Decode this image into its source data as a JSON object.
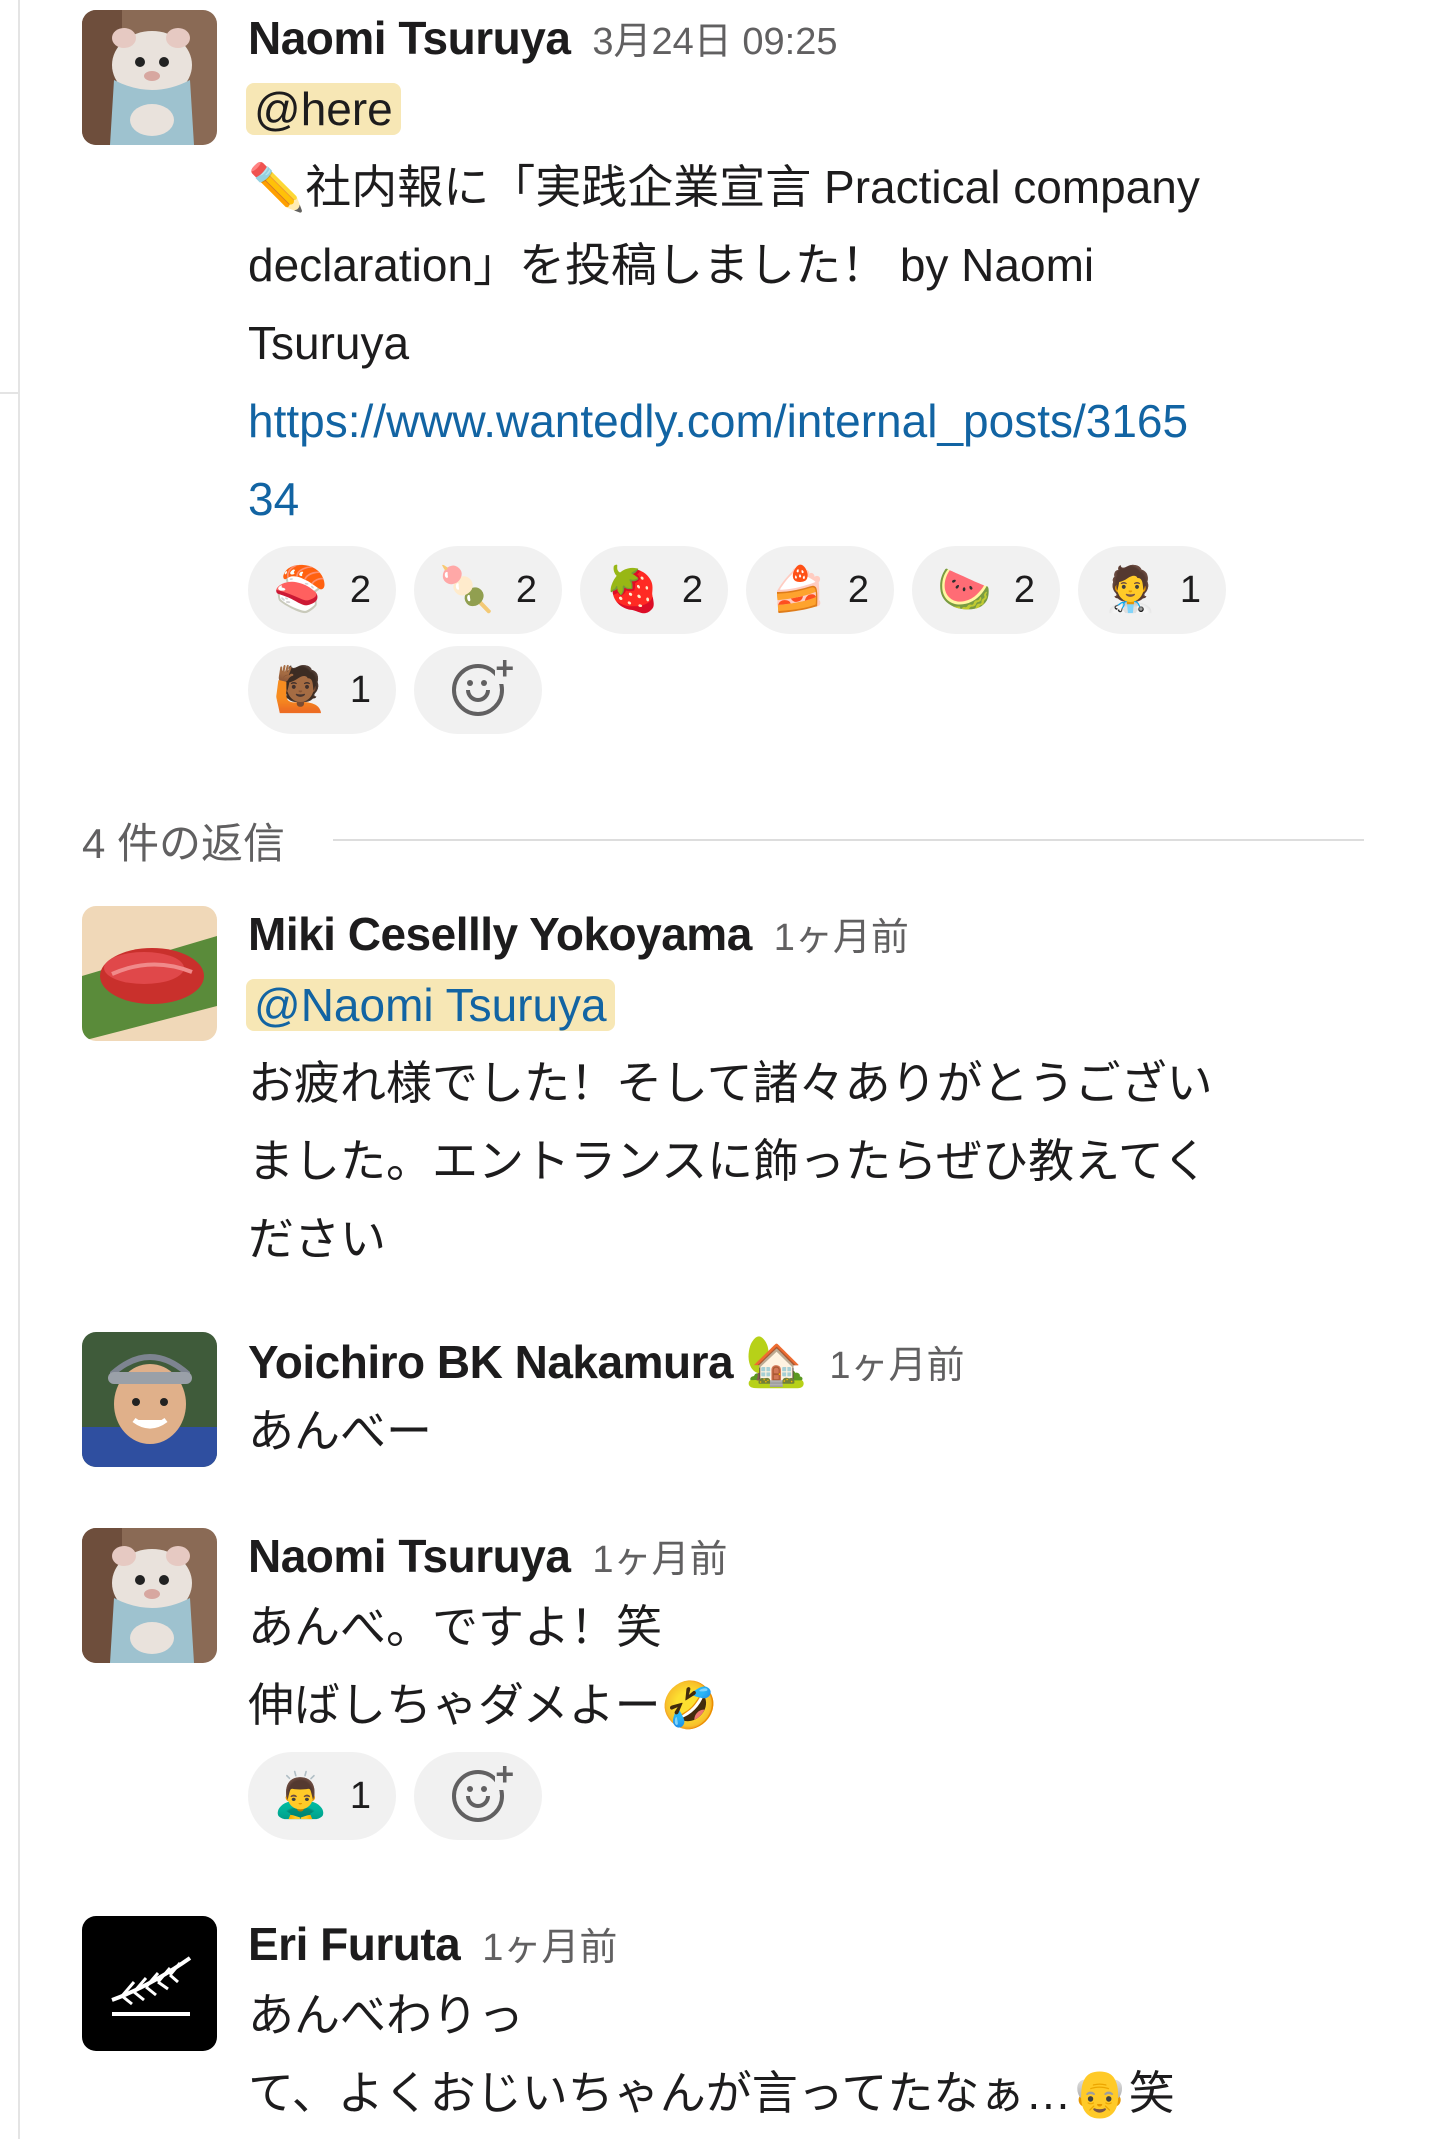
{
  "thread": {
    "parent": {
      "sender": "Naomi Tsuruya",
      "timestamp": "3月24日 09:25",
      "mention": "@here",
      "lines": [
        "✏️社内報に「実践企業宣言 Practical company",
        "declaration」を投稿しました！ by Naomi",
        "Tsuruya"
      ],
      "link_lines": [
        "https://www.wantedly.com/internal_posts/3165",
        "34"
      ],
      "reactions": [
        {
          "emoji": "🍣",
          "name": "sushi",
          "count": "2"
        },
        {
          "emoji": "🍡",
          "name": "dango",
          "count": "2"
        },
        {
          "emoji": "🍓",
          "name": "strawberry",
          "count": "2"
        },
        {
          "emoji": "🍰",
          "name": "shortcake",
          "count": "2"
        },
        {
          "emoji": "🍉",
          "name": "watermelon",
          "count": "2"
        },
        {
          "emoji": "🧑‍⚕️",
          "name": "health-worker",
          "count": "1"
        },
        {
          "emoji": "🙋🏾",
          "name": "person-raising-hand",
          "count": "1"
        }
      ]
    },
    "reply_count_label": "4 件の返信",
    "replies": [
      {
        "sender": "Miki Cesellly Yokoyama",
        "status_emoji": "",
        "timestamp": "1ヶ月前",
        "mention": "@Naomi Tsuruya",
        "lines": [
          "お疲れ様でした！そして諸々ありがとうござい",
          "ました。エントランスに飾ったらぜひ教えてく",
          "ださい"
        ]
      },
      {
        "sender": "Yoichiro BK Nakamura",
        "status_emoji": "🏡",
        "timestamp": "1ヶ月前",
        "lines": [
          "あんべー"
        ]
      },
      {
        "sender": "Naomi Tsuruya",
        "timestamp": "1ヶ月前",
        "lines": [
          "あんべ。ですよ！笑",
          "伸ばしちゃダメよー🤣"
        ],
        "reactions": [
          {
            "emoji": "🙇‍♂️",
            "name": "bow",
            "count": "1"
          }
        ]
      },
      {
        "sender": "Eri Furuta",
        "timestamp": "1ヶ月前",
        "lines": [
          "あんべわりっ",
          "て、よくおじいちゃんが言ってたなぁ…👴笑"
        ]
      }
    ]
  },
  "colors": {
    "link": "#1264a3",
    "mention_bg": "#f7e7b5",
    "reaction_bg": "#f1f1f1",
    "muted_text": "#616061"
  }
}
